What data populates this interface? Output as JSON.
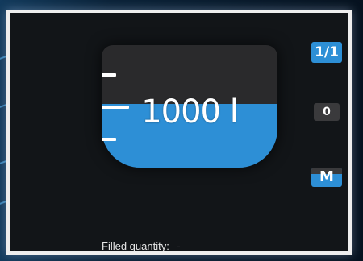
{
  "tank": {
    "level_text": "1000 l",
    "fill_fraction": 0.52,
    "colors": {
      "fill": "#2d8fd6",
      "empty": "#2a2a2c"
    }
  },
  "controls": {
    "page_indicator": "1/1",
    "count_value": "0",
    "mode_label": "M"
  },
  "status": {
    "filled_quantity_label": "Filled quantity:",
    "filled_quantity_value": "-"
  },
  "colors": {
    "accent": "#2d8fd6",
    "panel_bg": "#121518",
    "border": "#eeeeee"
  }
}
